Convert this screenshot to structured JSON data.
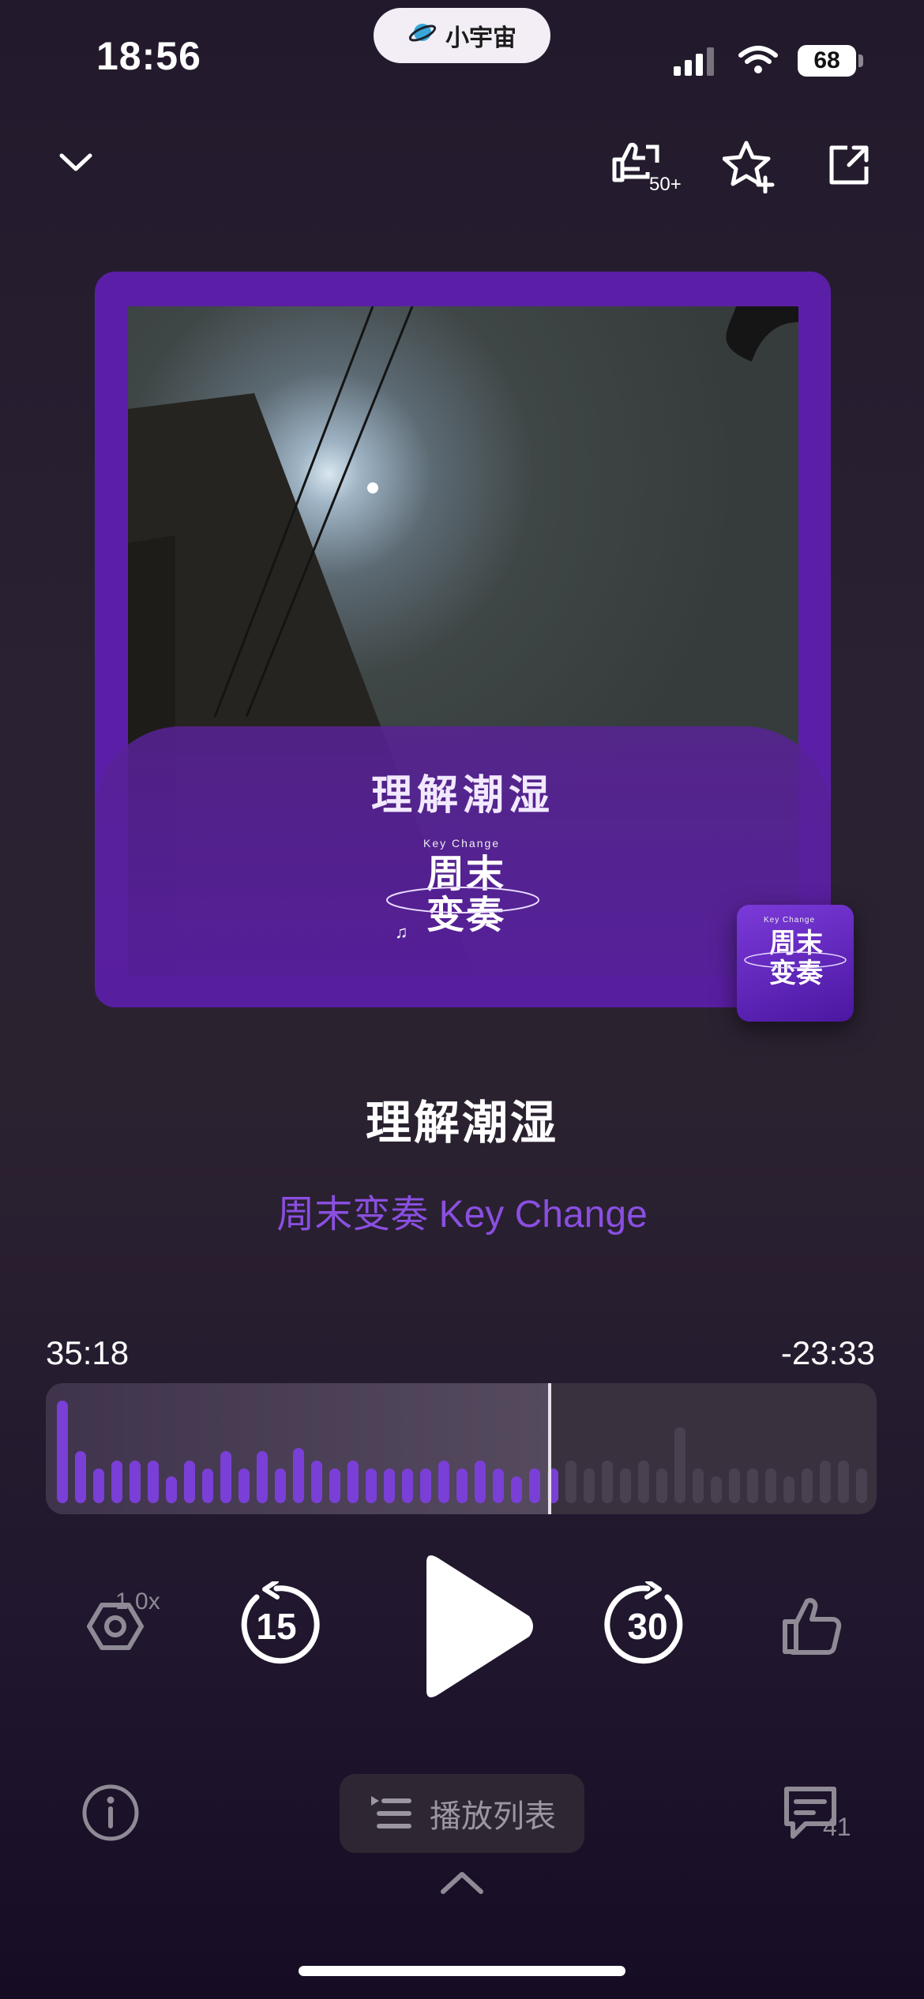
{
  "status_bar": {
    "time": "18:56",
    "pill_label": "小宇宙",
    "battery": "68"
  },
  "top_bar": {
    "like_count": "50+"
  },
  "artwork": {
    "cover_title": "理解潮湿",
    "logo_tagline": "Key Change",
    "logo_text": "周末变奏"
  },
  "episode": {
    "title": "理解潮湿",
    "podcast": "周末变奏 Key Change"
  },
  "progress": {
    "elapsed": "35:18",
    "remaining": "-23:33",
    "played_fraction": 0.607
  },
  "controls": {
    "speed": "1.0x",
    "rewind_seconds": "15",
    "forward_seconds": "30"
  },
  "bottom_bar": {
    "playlist_label": "播放列表",
    "comment_count": "41"
  },
  "colors": {
    "accent": "#8a4fe0",
    "frame": "#5b1fa7",
    "wave_played": "#7a3fd6",
    "wave_unplayed": "#4a4150"
  }
}
